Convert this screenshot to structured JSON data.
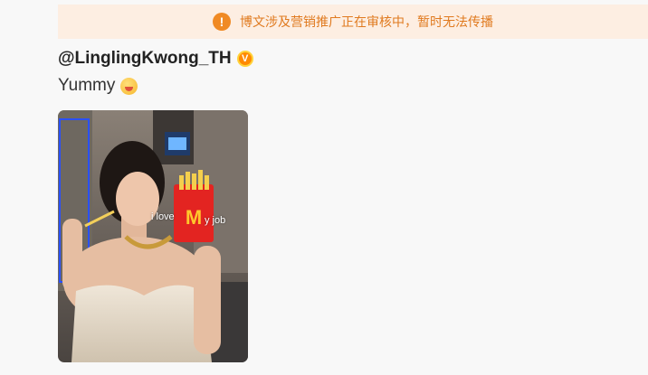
{
  "notice": {
    "icon": "exclamation-icon",
    "icon_glyph": "!",
    "text": "博文涉及营销推广正在审核中，暂时无法传播",
    "color": "#e07a1f",
    "background": "#fdeee2"
  },
  "post": {
    "username": "@LinglingKwong_TH",
    "verified_icon": "verified-badge-icon",
    "verified_glyph": "V",
    "text": "Yummy",
    "emoji_icon": "yum-face-emoji",
    "image": {
      "subject": "woman-eating-fries-photo",
      "caption_left": "i love",
      "caption_right": "y job"
    }
  }
}
